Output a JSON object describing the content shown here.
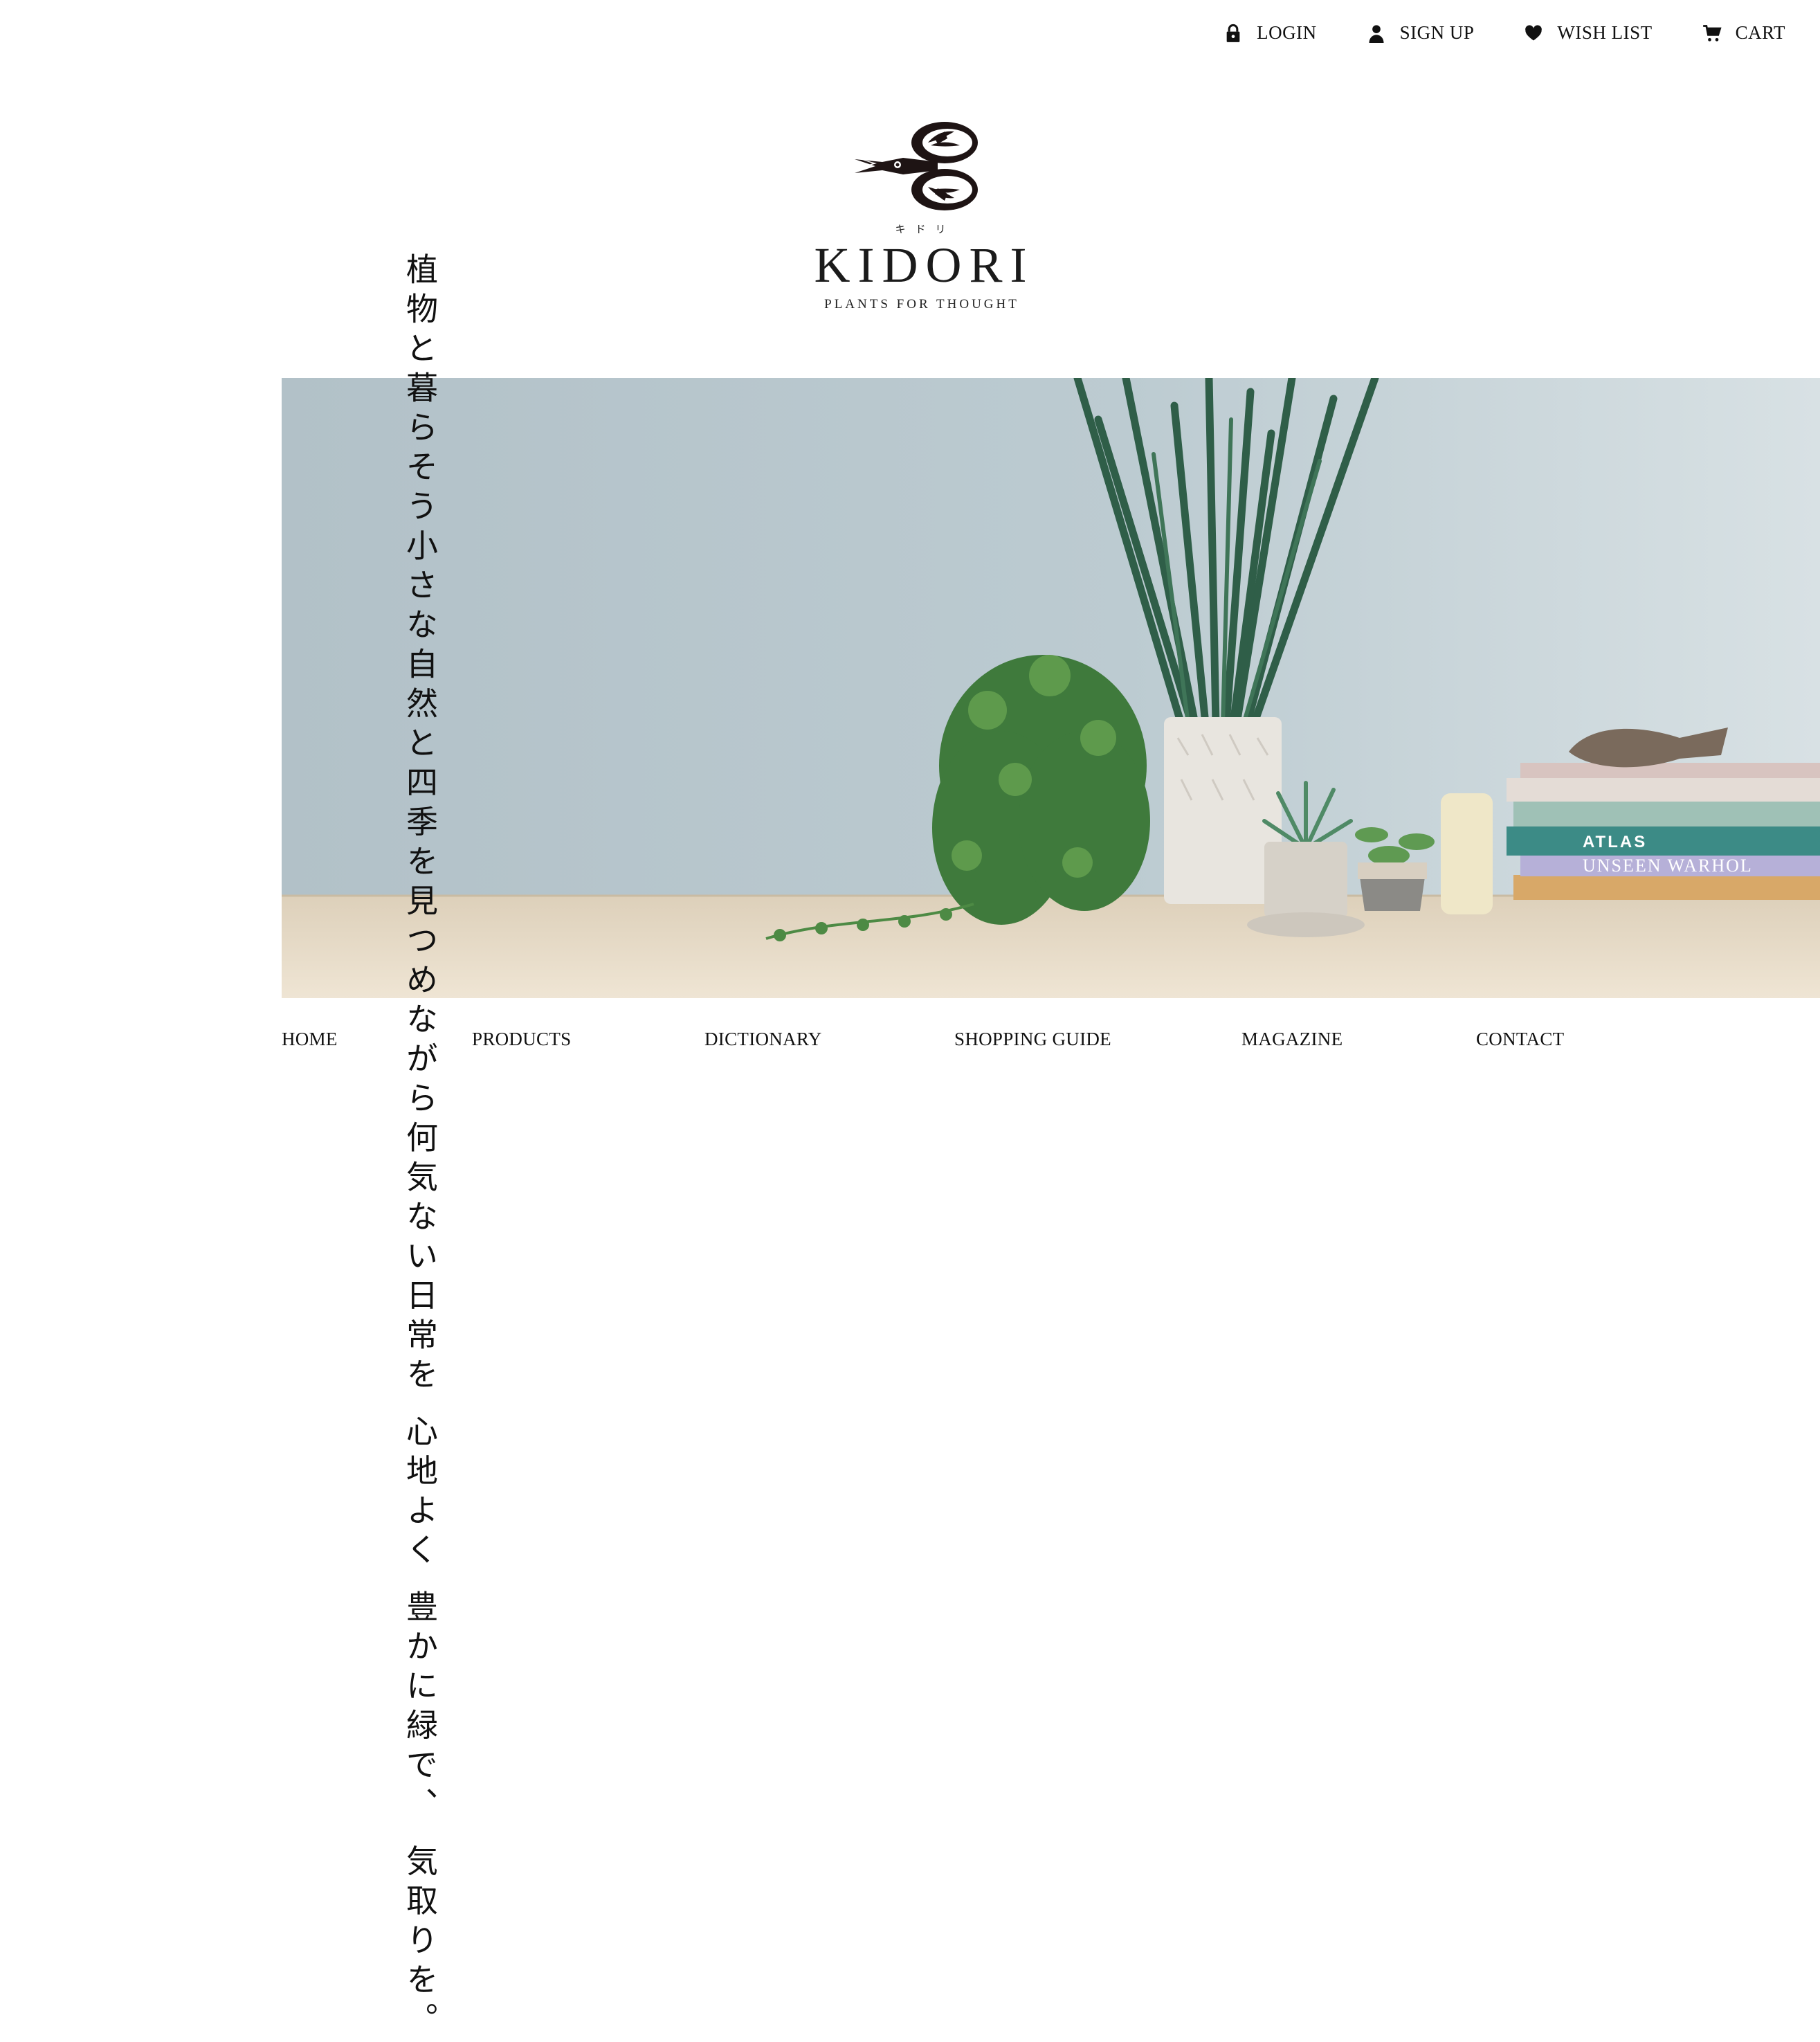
{
  "top_nav": {
    "login": "LOGIN",
    "signup": "SIGN UP",
    "wishlist": "WISH LIST",
    "cart": "CART"
  },
  "brand": {
    "kana": "キドリ",
    "name": "KIDORI",
    "tagline": "PLANTS FOR THOUGHT"
  },
  "catch_copy": [
    "植物と暮らそう",
    "小さな自然と四季を見つめながら",
    "何気ない日常を 心地よく 豊かに",
    "緑で、 気取りを。"
  ],
  "hero": {
    "book_titles": [
      "ATLAS",
      "UNSEEN WARHOL"
    ]
  },
  "main_nav": [
    "HOME",
    "PRODUCTS",
    "DICTIONARY",
    "SHOPPING GUIDE",
    "MAGAZINE",
    "CONTACT"
  ],
  "colors": {
    "text": "#111111",
    "background": "#ffffff",
    "hero_wall": "#b7c6cc",
    "hero_table": "#e6d9c4"
  },
  "icons": {
    "login": "lock-icon",
    "signup": "user-icon",
    "wishlist": "heart-icon",
    "cart": "cart-icon"
  }
}
